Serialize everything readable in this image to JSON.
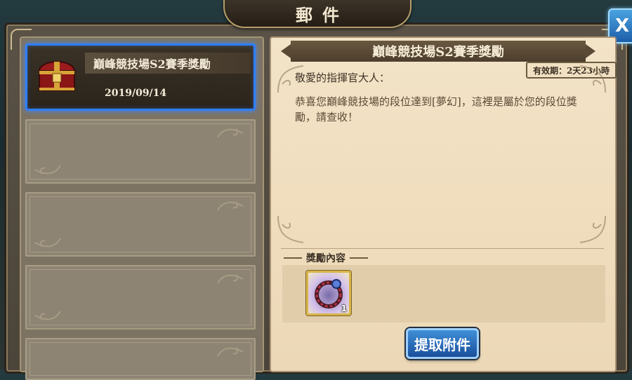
{
  "window": {
    "title": "郵件",
    "close_label": "X"
  },
  "mail_list": {
    "items": [
      {
        "subject": "巔峰競技場S2賽季獎勵",
        "date": "2019/09/14",
        "selected": true,
        "icon": "treasure-chest-icon"
      }
    ],
    "empty_slots": 4
  },
  "letter": {
    "subject": "巔峰競技場S2賽季獎勵",
    "validity": "有效期：2天23小時",
    "salutation": "敬愛的指揮官大人：",
    "body": "恭喜您巔峰競技場的段位達到[夢幻]，這裡是屬於您的段位獎勵，請查收！",
    "reward_label": "獎勵內容",
    "rewards": [
      {
        "icon": "ring-icon",
        "count": "1"
      }
    ],
    "claim_label": "提取附件"
  },
  "colors": {
    "selected_border": "#2e7fff",
    "button_blue": "#1a4f9c",
    "parchment": "#f3e3c7"
  }
}
